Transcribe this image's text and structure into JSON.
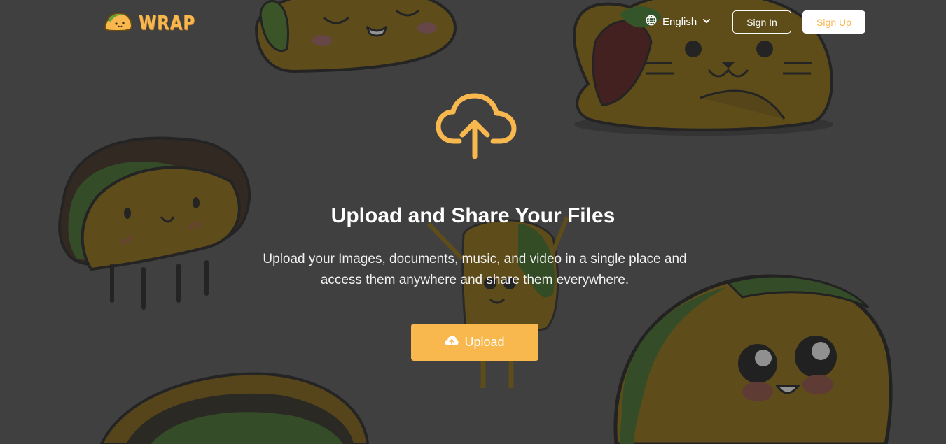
{
  "header": {
    "logo_text": "WRAP",
    "language": "English",
    "sign_in_label": "Sign In",
    "sign_up_label": "Sign Up"
  },
  "hero": {
    "title": "Upload and Share Your Files",
    "description": "Upload your Images, documents, music, and video in a single place and access them anywhere and share them everywhere.",
    "upload_label": "Upload"
  },
  "colors": {
    "accent": "#f8b84e",
    "overlay": "#555454",
    "text": "#ffffff"
  },
  "icons": {
    "logo": "taco-icon",
    "language": "globe-icon",
    "language_toggle": "chevron-down-icon",
    "hero": "cloud-upload-icon",
    "upload_button": "cloud-upload-icon"
  },
  "background": "cartoon-taco-illustrations"
}
